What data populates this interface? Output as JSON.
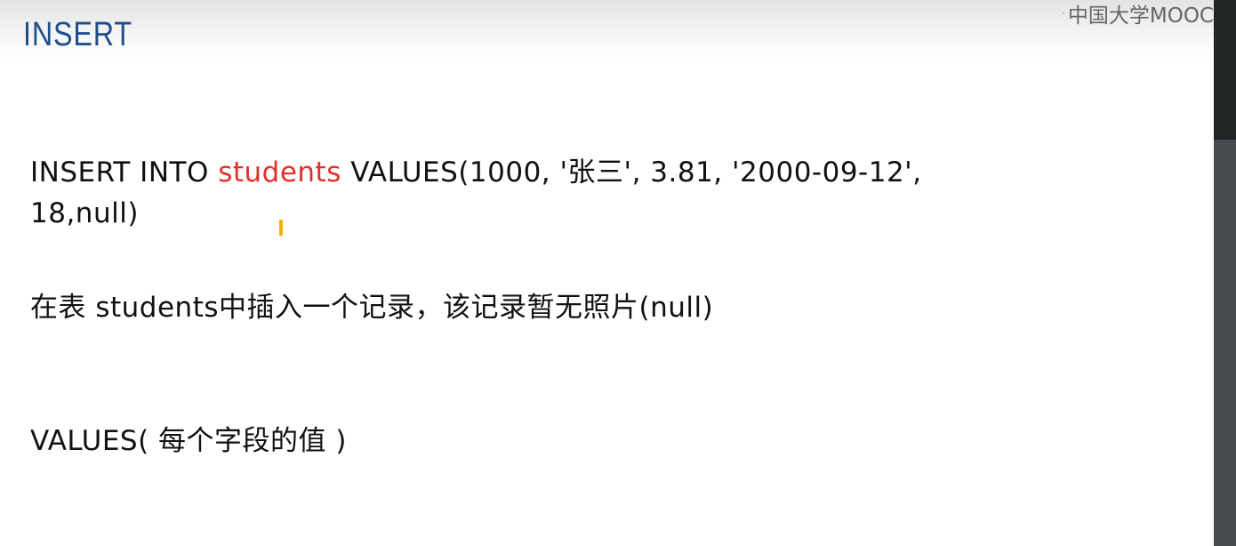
{
  "slide": {
    "title": "INSERT",
    "logo_text": "中国大学MOOC",
    "code_line1_prefix": "INSERT INTO ",
    "code_table": "students",
    "code_line1_suffix": " VALUES(1000, '张三', 3.81, '2000-09-12',",
    "code_line2": "18,null)",
    "description": "在表 students中插入一个记录，该记录暂无照片(null)",
    "values_note": "VALUES( 每个字段的值 )"
  },
  "colors": {
    "title": "#1f4e8c",
    "table_name": "#e0302a",
    "cursor": "#f0b400"
  }
}
